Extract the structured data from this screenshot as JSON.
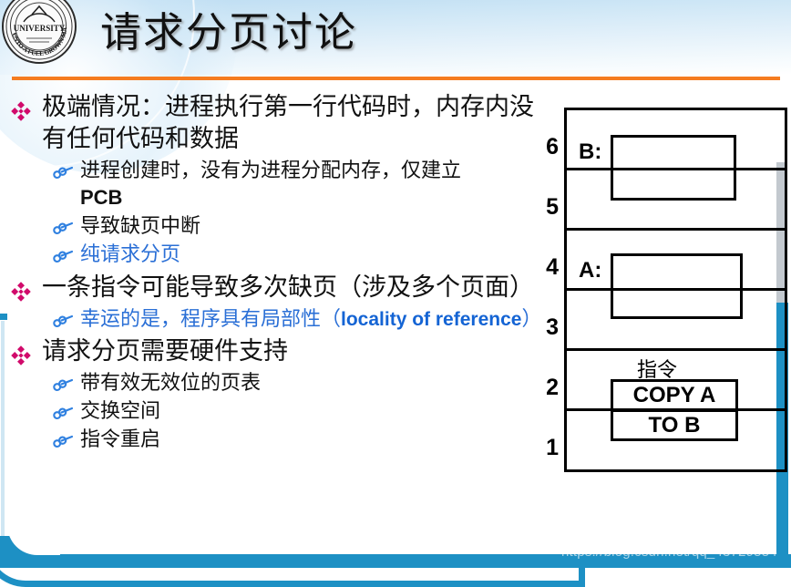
{
  "header": {
    "title": "请求分页讨论",
    "logo_alt": "university-seal",
    "rule_color": "#f57c20"
  },
  "theme": {
    "accent_blue": "#1d90c4",
    "bullet_l1_color": "#d10a6b",
    "bullet_l2_color": "#2f80e0",
    "link_blue": "#2a6fd6",
    "emphasis_blue": "#1464d4",
    "header_gradient_from": "#bcdcf2",
    "header_gradient_to": "#ffffff"
  },
  "content": {
    "bullets": [
      {
        "level": 1,
        "text": "极端情况：进程执行第一行代码时，内存内没有任何代码和数据"
      },
      {
        "level": 2,
        "text": "进程创建时，没有为进程分配内存，仅建立",
        "trailing_latin": "PCB"
      },
      {
        "level": 2,
        "text": "导致缺页中断"
      },
      {
        "level": 2,
        "text": "纯请求分页",
        "color": "blue"
      },
      {
        "level": 1,
        "text": "一条指令可能导致多次缺页（涉及多个页面）"
      },
      {
        "level": 2,
        "text_prefix": "幸运的是，程序具有局部性（",
        "emphasis": "locality of reference",
        "text_suffix": "）",
        "color": "blue"
      },
      {
        "level": 1,
        "text": "请求分页需要硬件支持"
      },
      {
        "level": 2,
        "text": "带有效无效位的页表"
      },
      {
        "level": 2,
        "text": "交换空间"
      },
      {
        "level": 2,
        "text": "指令重启"
      }
    ]
  },
  "diagram": {
    "name": "memory-frame-diagram",
    "frame_numbers": [
      "6",
      "5",
      "4",
      "3",
      "2",
      "1"
    ],
    "process_b": {
      "label": "B:",
      "spans_frames": [
        "6",
        "5"
      ],
      "box_content": ""
    },
    "process_a": {
      "label": "A:",
      "spans_frames": [
        "4",
        "3"
      ],
      "box_content": ""
    },
    "instruction": {
      "caption": "指令",
      "lines": [
        "COPY A",
        "TO B"
      ],
      "spans_frames": [
        "2",
        "1"
      ]
    }
  },
  "watermark": {
    "text": "https://blog.csdn.net/qq_43729554"
  }
}
